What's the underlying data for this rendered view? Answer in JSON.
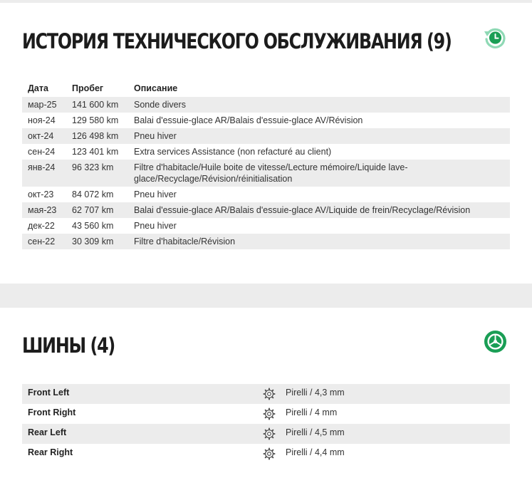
{
  "history": {
    "title": "ИСТОРИЯ ТЕХНИЧЕСКОГО ОБСЛУЖИВАНИЯ",
    "count": "(9)",
    "icon": "history-clock-icon",
    "columns": [
      "Дата",
      "Пробег",
      "Описание"
    ],
    "rows": [
      {
        "date": "мар-25",
        "mileage": "141 600 km",
        "description": "Sonde divers"
      },
      {
        "date": "ноя-24",
        "mileage": "129 580 km",
        "description": "Balai d'essuie-glace AR/Balais d'essuie-glace AV/Révision"
      },
      {
        "date": "окт-24",
        "mileage": "126 498 km",
        "description": "Pneu hiver"
      },
      {
        "date": "сен-24",
        "mileage": "123 401 km",
        "description": "Extra services Assistance (non refacturé au client)"
      },
      {
        "date": "янв-24",
        "mileage": "96 323 km",
        "description": "Filtre d'habitacle/Huile boite de vitesse/Lecture mémoire/Liquide lave-glace/Recyclage/Révision/réinitialisation"
      },
      {
        "date": "окт-23",
        "mileage": "84 072 km",
        "description": "Pneu hiver"
      },
      {
        "date": "мая-23",
        "mileage": "62 707 km",
        "description": "Balai d'essuie-glace AR/Balais d'essuie-glace AV/Liquide de frein/Recyclage/Révision"
      },
      {
        "date": "дек-22",
        "mileage": "43 560 km",
        "description": "Pneu hiver"
      },
      {
        "date": "сен-22",
        "mileage": "30 309 km",
        "description": "Filtre d'habitacle/Révision"
      }
    ]
  },
  "tires": {
    "title": "ШИНЫ",
    "count": "(4)",
    "icon": "tire-wheel-icon",
    "rows": [
      {
        "position": "Front Left",
        "icon": "gear-icon",
        "value": "Pirelli / 4,3 mm"
      },
      {
        "position": "Front Right",
        "icon": "gear-icon",
        "value": "Pirelli / 4 mm"
      },
      {
        "position": "Rear Left",
        "icon": "gear-icon",
        "value": "Pirelli / 4,5 mm"
      },
      {
        "position": "Rear Right",
        "icon": "gear-icon",
        "value": "Pirelli / 4,4 mm"
      }
    ]
  },
  "colors": {
    "accent": "#1a9e55",
    "accent_light": "#8fd9b5",
    "stripe": "#ececec",
    "page_background": "#ececec"
  }
}
